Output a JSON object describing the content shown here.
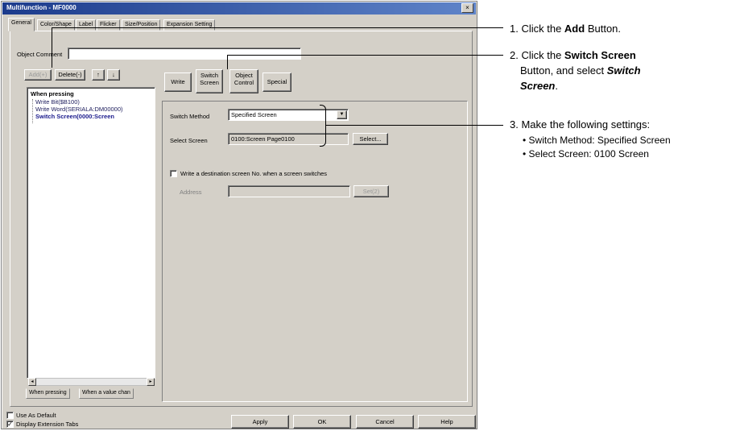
{
  "window": {
    "title": "Multifunction - MF0000",
    "close_glyph": "×"
  },
  "tabs": [
    {
      "label": "General"
    },
    {
      "label": "Color/Shape"
    },
    {
      "label": "Label"
    },
    {
      "label": "Flicker"
    },
    {
      "label": "Size/Position"
    },
    {
      "label": "Expansion Setting"
    }
  ],
  "object_comment": {
    "label": "Object Comment",
    "value": ""
  },
  "list_buttons": {
    "add": "Add(+)",
    "delete": "Delete(-)",
    "up": "↑",
    "down": "↓"
  },
  "tree": {
    "root": "When pressing",
    "items": [
      "Write Bit($B100)",
      "Write Word(SERIALA:DM00000)",
      "Switch Screen(0000:Screen"
    ]
  },
  "subtabs": [
    "When pressing",
    "When a value chan"
  ],
  "action_buttons": {
    "write": "Write",
    "switch_screen_line1": "Switch",
    "switch_screen_line2": "Screen",
    "object_control_line1": "Object",
    "object_control_line2": "Control",
    "special": "Special"
  },
  "form": {
    "switch_method_label": "Switch Method",
    "switch_method_value": "Specified Screen",
    "select_screen_label": "Select Screen",
    "select_screen_value": "0100:Screen Page0100",
    "select_button": "Select...",
    "write_dest_label": "Write a destination screen No. when a screen switches",
    "address_label": "Address",
    "address_value": "",
    "set_button": "Set(2)"
  },
  "bottom": {
    "use_as_default": "Use As Default",
    "display_extension_tabs": "Display Extension Tabs",
    "display_extension_checked": "✓",
    "apply": "Apply",
    "ok": "OK",
    "cancel": "Cancel",
    "help": "Help"
  },
  "instructions": {
    "step1_pre": "1. Click the ",
    "step1_bold": "Add",
    "step1_post": " Button.",
    "step2_pre": "2. Click the ",
    "step2_bold": "Switch Screen",
    "step2_line2_pre": "Button, and select ",
    "step2_line2_bi": "Switch",
    "step2_line3_bi": "Screen",
    "step2_line3_post": ".",
    "step3_title": "3. Make the following settings:",
    "step3_items": [
      "Switch Method: Specified Screen",
      "Select Screen: 0100 Screen"
    ]
  }
}
